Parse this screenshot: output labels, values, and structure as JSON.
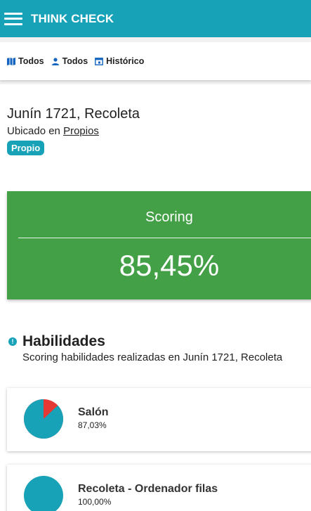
{
  "app": {
    "title": "THINK CHECK"
  },
  "filters": [
    {
      "label": "Todos",
      "icon": "map-icon"
    },
    {
      "label": "Todos",
      "icon": "person-icon"
    },
    {
      "label": "Histórico",
      "icon": "calendar-icon"
    }
  ],
  "location": {
    "title": "Junín 1721, Recoleta",
    "located_prefix": "Ubicado en",
    "located_link": "Propios",
    "badge": "Propio"
  },
  "scoring": {
    "label": "Scoring",
    "value": "85,45%"
  },
  "skills": {
    "title": "Habilidades",
    "subtitle": "Scoring habilidades realizadas en Junín 1721, Recoleta",
    "icon": "info-badge-icon",
    "items": [
      {
        "name": "Salón",
        "percent_text": "87,03%",
        "percent": 87.03
      },
      {
        "name": "Recoleta - Ordenador filas",
        "percent_text": "100,00%",
        "percent": 100.0
      }
    ]
  },
  "colors": {
    "primary": "#17a2b8",
    "scoring_bg": "#43a047",
    "pie_fill": "#17a2b8",
    "pie_miss": "#e53935"
  }
}
